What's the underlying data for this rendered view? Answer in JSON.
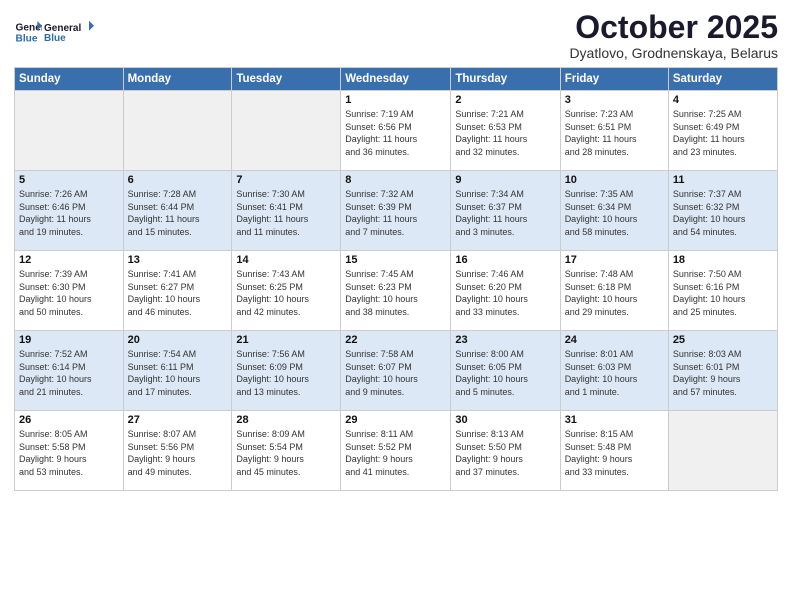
{
  "logo": {
    "line1": "General",
    "line2": "Blue"
  },
  "title": "October 2025",
  "subtitle": "Dyatlovo, Grodnenskaya, Belarus",
  "weekdays": [
    "Sunday",
    "Monday",
    "Tuesday",
    "Wednesday",
    "Thursday",
    "Friday",
    "Saturday"
  ],
  "weeks": [
    [
      {
        "day": "",
        "info": ""
      },
      {
        "day": "",
        "info": ""
      },
      {
        "day": "",
        "info": ""
      },
      {
        "day": "1",
        "info": "Sunrise: 7:19 AM\nSunset: 6:56 PM\nDaylight: 11 hours\nand 36 minutes."
      },
      {
        "day": "2",
        "info": "Sunrise: 7:21 AM\nSunset: 6:53 PM\nDaylight: 11 hours\nand 32 minutes."
      },
      {
        "day": "3",
        "info": "Sunrise: 7:23 AM\nSunset: 6:51 PM\nDaylight: 11 hours\nand 28 minutes."
      },
      {
        "day": "4",
        "info": "Sunrise: 7:25 AM\nSunset: 6:49 PM\nDaylight: 11 hours\nand 23 minutes."
      }
    ],
    [
      {
        "day": "5",
        "info": "Sunrise: 7:26 AM\nSunset: 6:46 PM\nDaylight: 11 hours\nand 19 minutes."
      },
      {
        "day": "6",
        "info": "Sunrise: 7:28 AM\nSunset: 6:44 PM\nDaylight: 11 hours\nand 15 minutes."
      },
      {
        "day": "7",
        "info": "Sunrise: 7:30 AM\nSunset: 6:41 PM\nDaylight: 11 hours\nand 11 minutes."
      },
      {
        "day": "8",
        "info": "Sunrise: 7:32 AM\nSunset: 6:39 PM\nDaylight: 11 hours\nand 7 minutes."
      },
      {
        "day": "9",
        "info": "Sunrise: 7:34 AM\nSunset: 6:37 PM\nDaylight: 11 hours\nand 3 minutes."
      },
      {
        "day": "10",
        "info": "Sunrise: 7:35 AM\nSunset: 6:34 PM\nDaylight: 10 hours\nand 58 minutes."
      },
      {
        "day": "11",
        "info": "Sunrise: 7:37 AM\nSunset: 6:32 PM\nDaylight: 10 hours\nand 54 minutes."
      }
    ],
    [
      {
        "day": "12",
        "info": "Sunrise: 7:39 AM\nSunset: 6:30 PM\nDaylight: 10 hours\nand 50 minutes."
      },
      {
        "day": "13",
        "info": "Sunrise: 7:41 AM\nSunset: 6:27 PM\nDaylight: 10 hours\nand 46 minutes."
      },
      {
        "day": "14",
        "info": "Sunrise: 7:43 AM\nSunset: 6:25 PM\nDaylight: 10 hours\nand 42 minutes."
      },
      {
        "day": "15",
        "info": "Sunrise: 7:45 AM\nSunset: 6:23 PM\nDaylight: 10 hours\nand 38 minutes."
      },
      {
        "day": "16",
        "info": "Sunrise: 7:46 AM\nSunset: 6:20 PM\nDaylight: 10 hours\nand 33 minutes."
      },
      {
        "day": "17",
        "info": "Sunrise: 7:48 AM\nSunset: 6:18 PM\nDaylight: 10 hours\nand 29 minutes."
      },
      {
        "day": "18",
        "info": "Sunrise: 7:50 AM\nSunset: 6:16 PM\nDaylight: 10 hours\nand 25 minutes."
      }
    ],
    [
      {
        "day": "19",
        "info": "Sunrise: 7:52 AM\nSunset: 6:14 PM\nDaylight: 10 hours\nand 21 minutes."
      },
      {
        "day": "20",
        "info": "Sunrise: 7:54 AM\nSunset: 6:11 PM\nDaylight: 10 hours\nand 17 minutes."
      },
      {
        "day": "21",
        "info": "Sunrise: 7:56 AM\nSunset: 6:09 PM\nDaylight: 10 hours\nand 13 minutes."
      },
      {
        "day": "22",
        "info": "Sunrise: 7:58 AM\nSunset: 6:07 PM\nDaylight: 10 hours\nand 9 minutes."
      },
      {
        "day": "23",
        "info": "Sunrise: 8:00 AM\nSunset: 6:05 PM\nDaylight: 10 hours\nand 5 minutes."
      },
      {
        "day": "24",
        "info": "Sunrise: 8:01 AM\nSunset: 6:03 PM\nDaylight: 10 hours\nand 1 minute."
      },
      {
        "day": "25",
        "info": "Sunrise: 8:03 AM\nSunset: 6:01 PM\nDaylight: 9 hours\nand 57 minutes."
      }
    ],
    [
      {
        "day": "26",
        "info": "Sunrise: 8:05 AM\nSunset: 5:58 PM\nDaylight: 9 hours\nand 53 minutes."
      },
      {
        "day": "27",
        "info": "Sunrise: 8:07 AM\nSunset: 5:56 PM\nDaylight: 9 hours\nand 49 minutes."
      },
      {
        "day": "28",
        "info": "Sunrise: 8:09 AM\nSunset: 5:54 PM\nDaylight: 9 hours\nand 45 minutes."
      },
      {
        "day": "29",
        "info": "Sunrise: 8:11 AM\nSunset: 5:52 PM\nDaylight: 9 hours\nand 41 minutes."
      },
      {
        "day": "30",
        "info": "Sunrise: 8:13 AM\nSunset: 5:50 PM\nDaylight: 9 hours\nand 37 minutes."
      },
      {
        "day": "31",
        "info": "Sunrise: 8:15 AM\nSunset: 5:48 PM\nDaylight: 9 hours\nand 33 minutes."
      },
      {
        "day": "",
        "info": ""
      }
    ]
  ]
}
